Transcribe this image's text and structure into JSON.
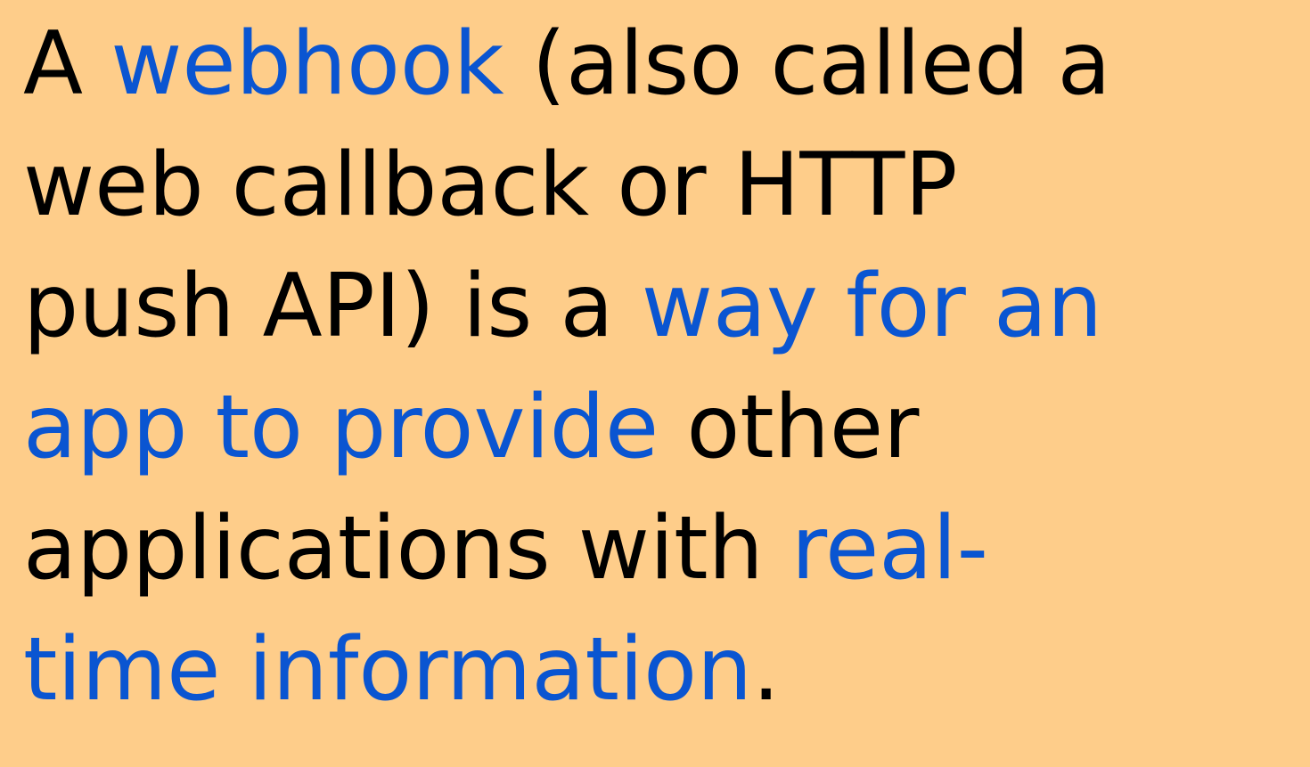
{
  "colors": {
    "background": "#fecd8a",
    "text": "#000000",
    "highlight": "#0a55d1"
  },
  "text": {
    "l1_a": "A ",
    "l1_b": "webhook",
    "l1_c": " (also called a",
    "l2": "web callback or HTTP",
    "l3_a": "push API) is a ",
    "l3_b": "way for an",
    "l4_a": "app to provide",
    "l4_b": " other",
    "l5_a": "applications with ",
    "l5_b": "real-",
    "l6_a": "time information",
    "l6_b": "."
  }
}
